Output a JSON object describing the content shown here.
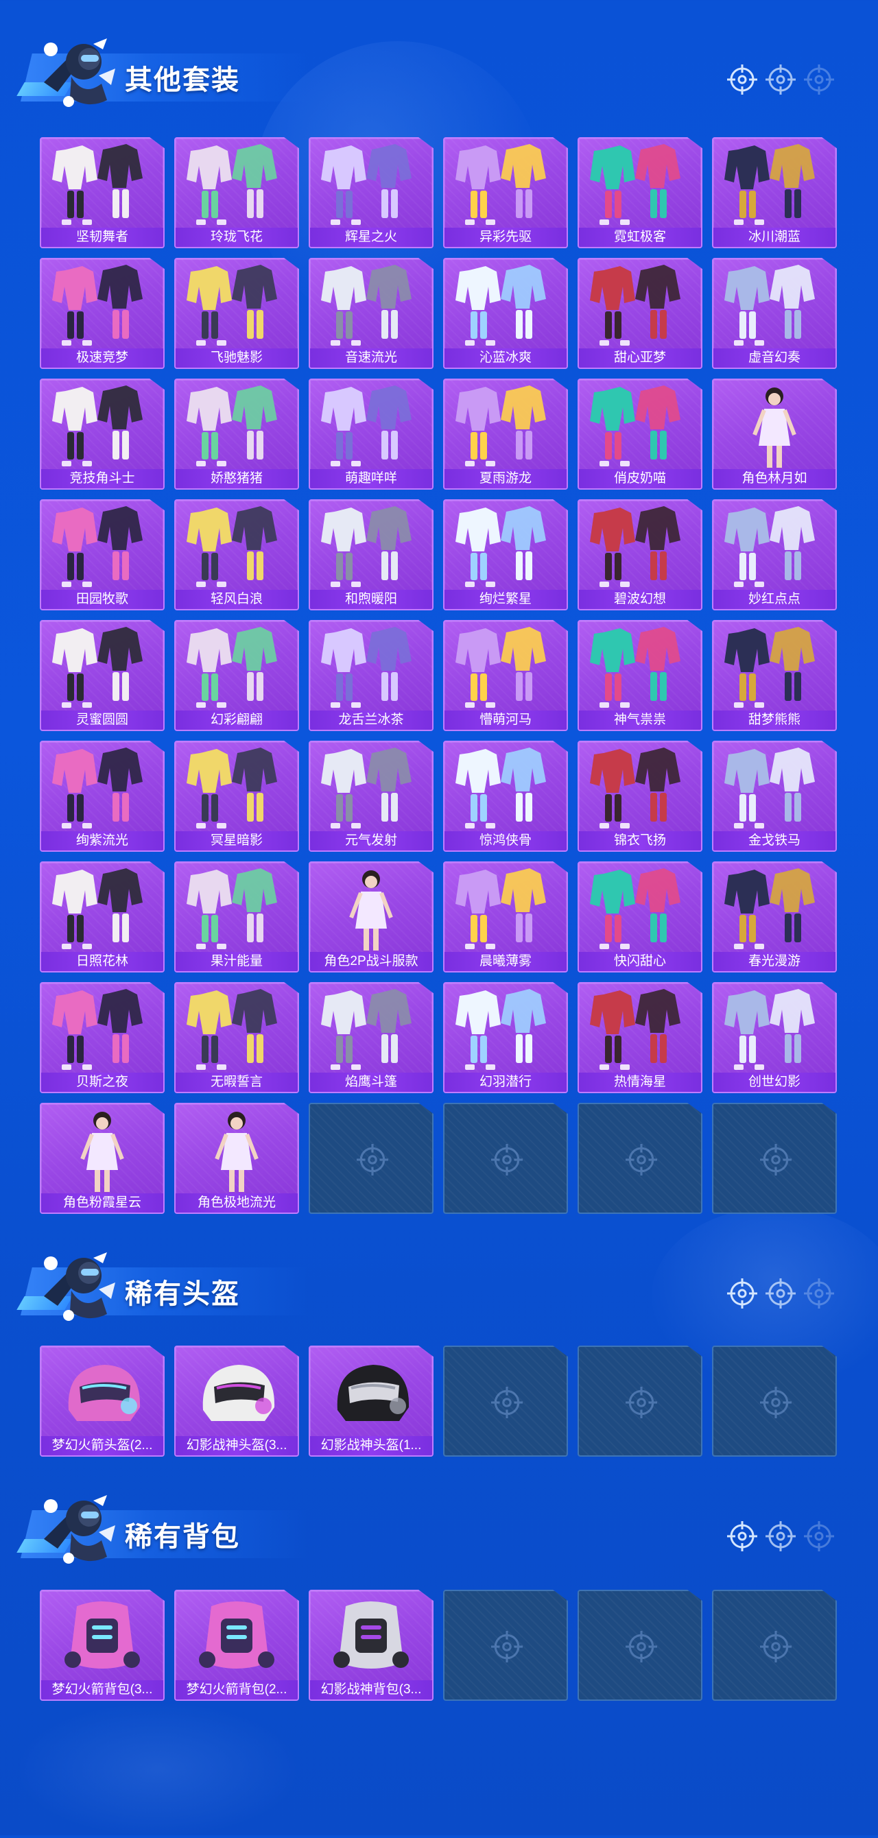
{
  "colors": {
    "background": "#0a52d6",
    "card_purple": "#9a48e6",
    "label_bar": "#8f3cf0",
    "empty_slot": "#1e4b82",
    "reticle": "#cfe3ff"
  },
  "sections": {
    "outfits": {
      "title": "其他套装",
      "items": [
        {
          "name": "坚韧舞者",
          "icon": "outfit-white"
        },
        {
          "name": "玲珑飞花",
          "icon": "outfit-floral"
        },
        {
          "name": "辉星之火",
          "icon": "outfit-purple"
        },
        {
          "name": "异彩先驱",
          "icon": "outfit-colorful"
        },
        {
          "name": "霓虹极客",
          "icon": "outfit-neon"
        },
        {
          "name": "冰川潮蓝",
          "icon": "outfit-dark-gold"
        },
        {
          "name": "极速竞梦",
          "icon": "outfit-racer-pink"
        },
        {
          "name": "飞驰魅影",
          "icon": "outfit-racer-gold"
        },
        {
          "name": "音速流光",
          "icon": "outfit-silver"
        },
        {
          "name": "沁蓝冰爽",
          "icon": "outfit-light"
        },
        {
          "name": "甜心亚梦",
          "icon": "outfit-red"
        },
        {
          "name": "虚音幻奏",
          "icon": "outfit-stripe"
        },
        {
          "name": "竞技角斗士",
          "icon": "outfit-armor-blue"
        },
        {
          "name": "娇憨猪猪",
          "icon": "outfit-pink"
        },
        {
          "name": "萌趣咩咩",
          "icon": "outfit-sky"
        },
        {
          "name": "夏雨游龙",
          "icon": "outfit-green"
        },
        {
          "name": "俏皮奶喵",
          "icon": "outfit-cow"
        },
        {
          "name": "角色林月如",
          "icon": "character-lin"
        },
        {
          "name": "田园牧歌",
          "icon": "outfit-pastoral"
        },
        {
          "name": "轻风白浪",
          "icon": "outfit-breeze"
        },
        {
          "name": "和煦暖阳",
          "icon": "outfit-sunny"
        },
        {
          "name": "绚烂繁星",
          "icon": "outfit-star"
        },
        {
          "name": "碧波幻想",
          "icon": "outfit-wave"
        },
        {
          "name": "妙红点点",
          "icon": "outfit-red-dots"
        },
        {
          "name": "灵蜜圆圆",
          "icon": "outfit-honey"
        },
        {
          "name": "幻彩翩翩",
          "icon": "outfit-butterfly"
        },
        {
          "name": "龙舌兰冰茶",
          "icon": "outfit-lime"
        },
        {
          "name": "懵萌河马",
          "icon": "outfit-hippo"
        },
        {
          "name": "神气祟祟",
          "icon": "outfit-yellow"
        },
        {
          "name": "甜梦熊熊",
          "icon": "outfit-bear"
        },
        {
          "name": "绚紫流光",
          "icon": "outfit-lilac"
        },
        {
          "name": "冥星暗影",
          "icon": "outfit-shadow"
        },
        {
          "name": "元气发射",
          "icon": "outfit-launch"
        },
        {
          "name": "惊鸿侠骨",
          "icon": "outfit-wuxia"
        },
        {
          "name": "锦衣飞扬",
          "icon": "outfit-robe"
        },
        {
          "name": "金戈铁马",
          "icon": "outfit-general"
        },
        {
          "name": "日照花林",
          "icon": "outfit-bloom"
        },
        {
          "name": "果汁能量",
          "icon": "outfit-juice"
        },
        {
          "name": "角色2P战斗服款",
          "icon": "character-2p"
        },
        {
          "name": "晨曦薄雾",
          "icon": "outfit-mist"
        },
        {
          "name": "快闪甜心",
          "icon": "outfit-flash"
        },
        {
          "name": "春光漫游",
          "icon": "outfit-spring"
        },
        {
          "name": "贝斯之夜",
          "icon": "outfit-bass"
        },
        {
          "name": "无暇誓言",
          "icon": "outfit-vow"
        },
        {
          "name": "焰鹰斗篷",
          "icon": "outfit-flame-hawk"
        },
        {
          "name": "幻羽潜行",
          "icon": "outfit-feather"
        },
        {
          "name": "热情海星",
          "icon": "outfit-starfish"
        },
        {
          "name": "创世幻影",
          "icon": "outfit-genesis"
        },
        {
          "name": "角色粉霞星云",
          "icon": "character-pink"
        },
        {
          "name": "角色极地流光",
          "icon": "character-polar"
        }
      ],
      "empty_slots": 4
    },
    "helmets": {
      "title": "稀有头盔",
      "items": [
        {
          "name": "梦幻火箭头盔(2...",
          "icon": "helmet-pink"
        },
        {
          "name": "幻影战神头盔(3...",
          "icon": "helmet-white"
        },
        {
          "name": "幻影战神头盔(1...",
          "icon": "helmet-black"
        }
      ],
      "empty_slots": 3
    },
    "backpacks": {
      "title": "稀有背包",
      "items": [
        {
          "name": "梦幻火箭背包(3...",
          "icon": "backpack-pink"
        },
        {
          "name": "梦幻火箭背包(2...",
          "icon": "backpack-pink"
        },
        {
          "name": "幻影战神背包(3...",
          "icon": "backpack-silver"
        }
      ],
      "empty_slots": 3
    }
  }
}
